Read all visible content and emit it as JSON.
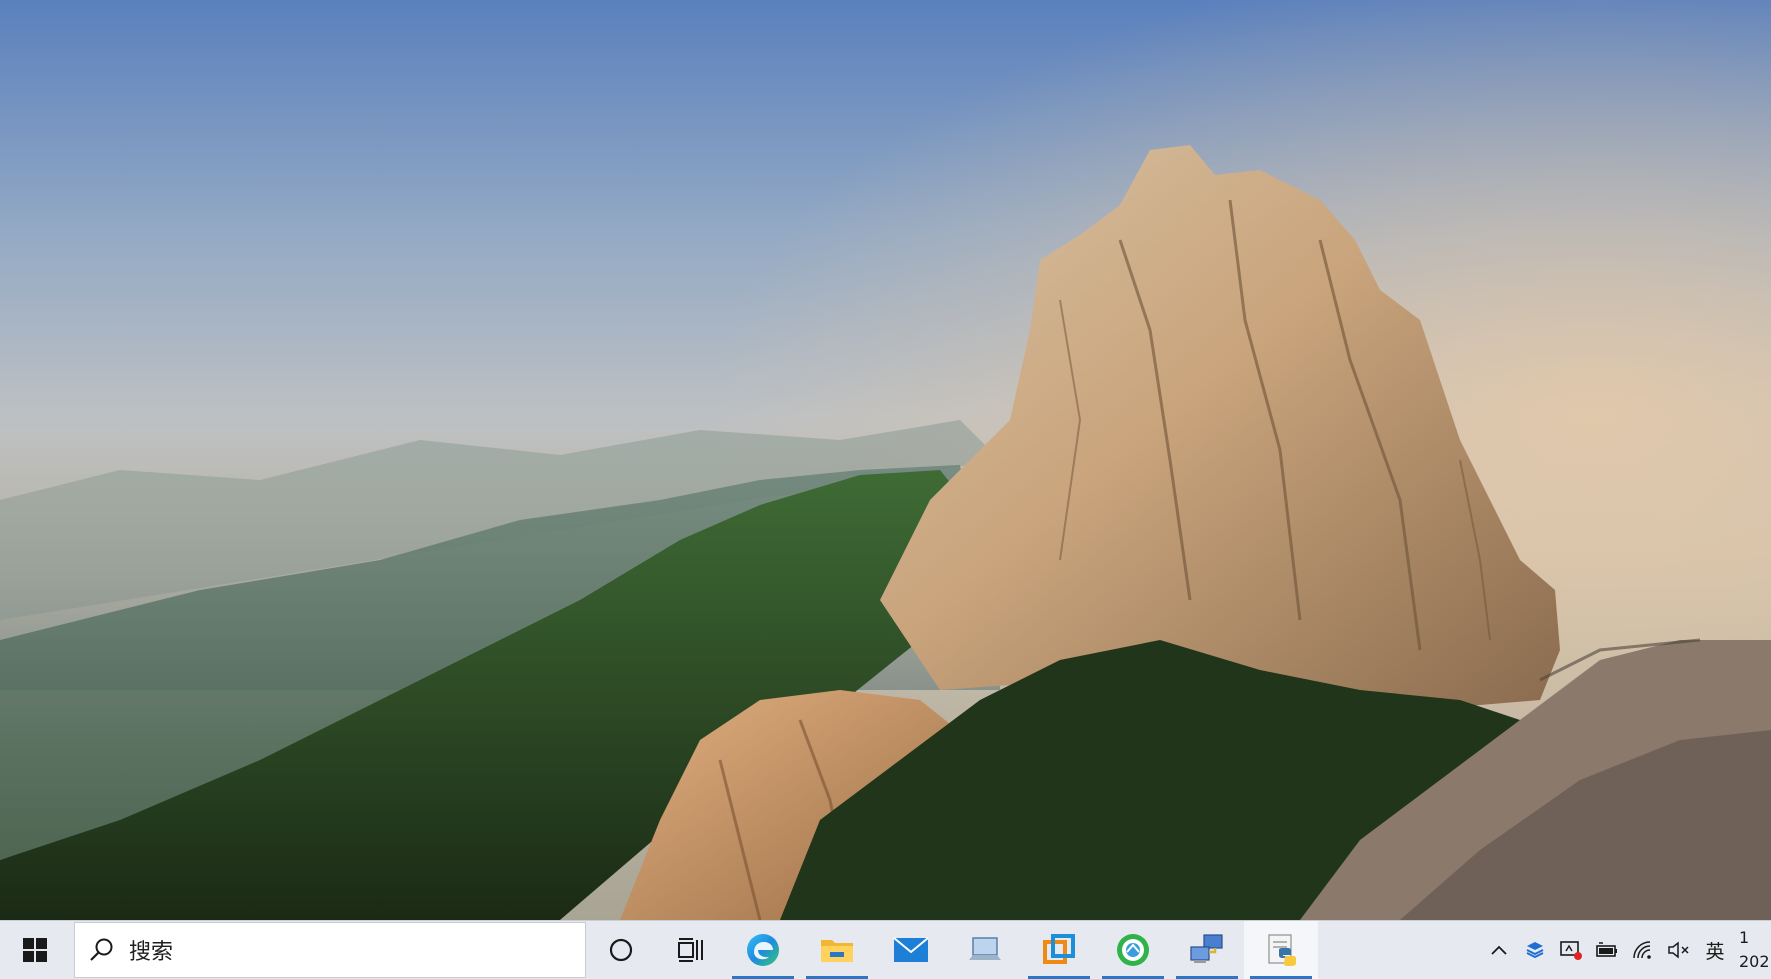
{
  "taskbar": {
    "search_placeholder": "搜索",
    "pinned_apps": [
      {
        "name": "edge-icon",
        "running": true
      },
      {
        "name": "file-explorer-icon",
        "running": true
      },
      {
        "name": "mail-icon",
        "running": false
      },
      {
        "name": "this-pc-icon",
        "running": false
      },
      {
        "name": "vmware-icon",
        "running": true
      },
      {
        "name": "green-circle-app-icon",
        "running": true
      },
      {
        "name": "network-computer-icon",
        "running": true
      },
      {
        "name": "python-notepad-icon",
        "running": true,
        "active": true
      }
    ],
    "tray": {
      "ime_label": "英",
      "clock_time": "1",
      "clock_date": "202"
    },
    "accent_color": "#2a77c9",
    "background_color": "#e6eaf0"
  }
}
